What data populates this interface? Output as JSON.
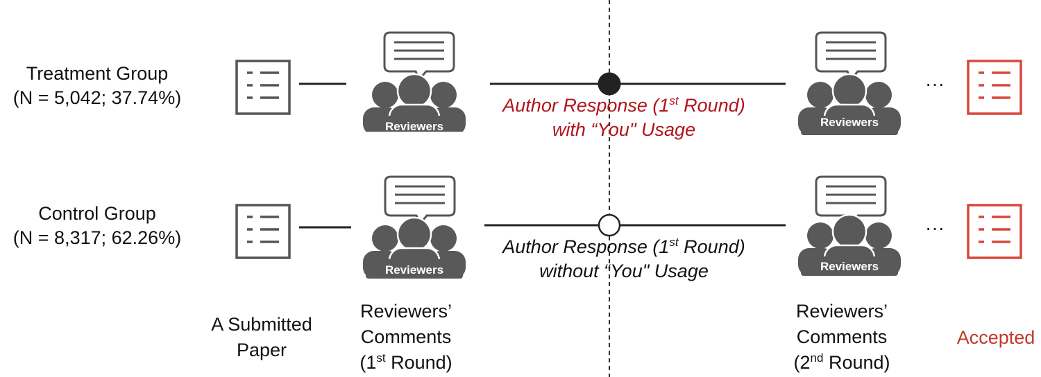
{
  "groups": {
    "treatment": {
      "name": "Treatment Group",
      "stats": "(N = 5,042; 37.74%)"
    },
    "control": {
      "name": "Control Group",
      "stats": "(N = 8,317; 62.26%)"
    }
  },
  "reviewer_badge": "Reviewers",
  "treatment_response": {
    "line1_pre": "Author Response (1",
    "line1_sup": "st",
    "line1_post": " Round)",
    "line2": "with “You\" Usage"
  },
  "control_response": {
    "line1_pre": "Author Response (1",
    "line1_sup": "st",
    "line1_post": " Round)",
    "line2": "without “You\" Usage"
  },
  "stages": {
    "submitted": {
      "line1": "A Submitted",
      "line2": "Paper"
    },
    "first_round": {
      "line1": "Reviewers’",
      "line2": "Comments",
      "line3_pre": "(1",
      "line3_sup": "st",
      "line3_post": " Round)"
    },
    "second_round": {
      "line1": "Reviewers’",
      "line2": "Comments",
      "line3_pre": "(2",
      "line3_sup": "nd",
      "line3_post": " Round)"
    },
    "accepted": "Accepted"
  },
  "ellipsis": "···",
  "colors": {
    "dark": "#4a4a4a",
    "red": "#b2141c",
    "accepted": "#d9473a",
    "icon_gray": "#595959"
  }
}
